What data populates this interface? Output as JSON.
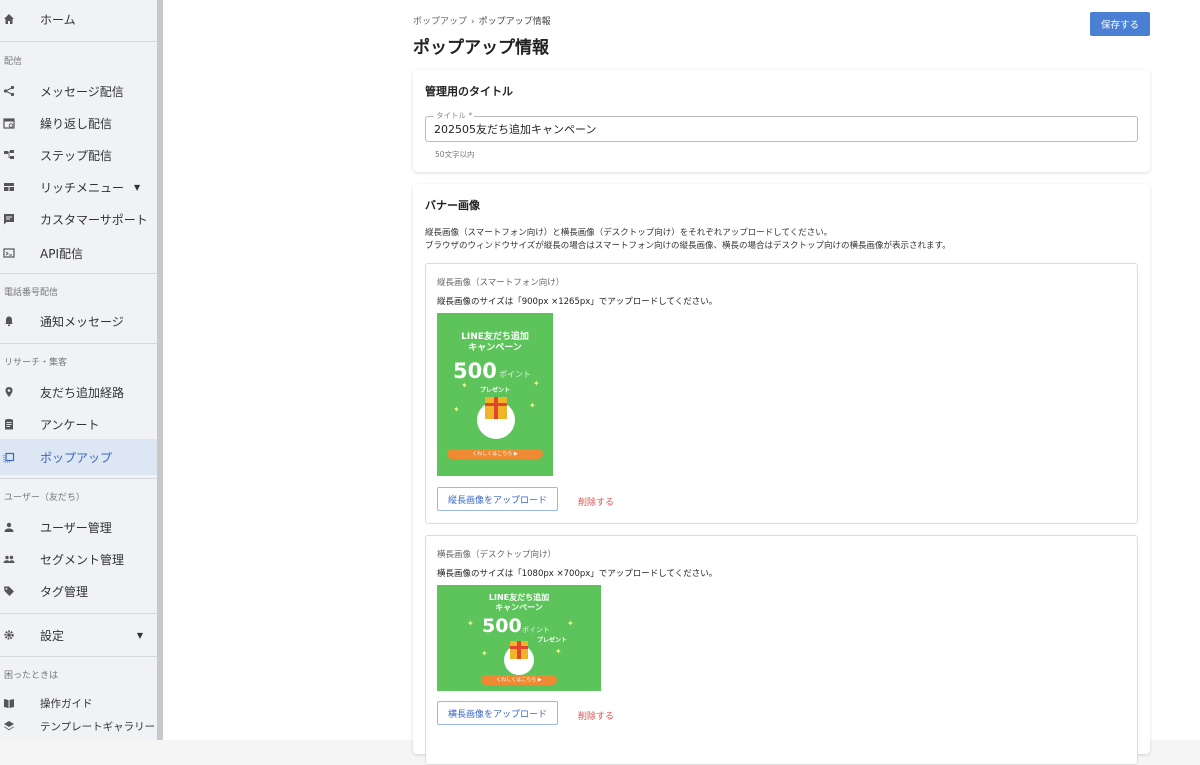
{
  "sidebar": {
    "home": "ホーム",
    "section_delivery": "配信",
    "message": "メッセージ配信",
    "repeat": "繰り返し配信",
    "step": "ステップ配信",
    "rich_menu": "リッチメニュー",
    "support": "カスタマーサポート",
    "api": "API配信",
    "section_phone": "電話番号配信",
    "notify": "通知メッセージ",
    "section_research": "リサーチ・集客",
    "friend_route": "友だち追加経路",
    "survey": "アンケート",
    "popup": "ポップアップ",
    "section_users": "ユーザー（友だち）",
    "user_mgmt": "ユーザー管理",
    "segment": "セグメント管理",
    "tag": "タグ管理",
    "settings": "設定",
    "section_help": "困ったときは",
    "guide": "操作ガイド",
    "template": "テンプレートギャラリー"
  },
  "header": {
    "breadcrumb_parent": "ポップアップ",
    "breadcrumb_sep": "›",
    "breadcrumb_current": "ポップアップ情報",
    "title": "ポップアップ情報",
    "save_label": "保存する"
  },
  "title_card": {
    "heading": "管理用のタイトル",
    "field_label": "タイトル *",
    "field_value": "202505友だち追加キャンペーン",
    "help": "50文字以内"
  },
  "banner_card": {
    "heading": "バナー画像",
    "desc1": "縦長画像（スマートフォン向け）と横長画像（デスクトップ向け）をそれぞれアップロードしてください。",
    "desc2": "ブラウザのウィンドウサイズが縦長の場合はスマートフォン向けの縦長画像、横長の場合はデスクトップ向けの横長画像が表示されます。",
    "portrait": {
      "title": "縦長画像（スマートフォン向け）",
      "desc": "縦長画像のサイズは「900px ×1265px」でアップロードしてください。",
      "upload_label": "縦長画像をアップロード",
      "delete_label": "削除する"
    },
    "landscape": {
      "title": "横長画像（デスクトップ向け）",
      "desc": "横長画像のサイズは「1080px ×700px」でアップロードしてください。",
      "upload_label": "横長画像をアップロード",
      "delete_label": "削除する"
    },
    "banner_art": {
      "line1": "LINE友だち追加",
      "line2": "キャンペーン",
      "number": "500",
      "unit": "ポイント",
      "present": "プレゼント",
      "cta": "くわしくはこちら ▶"
    }
  }
}
